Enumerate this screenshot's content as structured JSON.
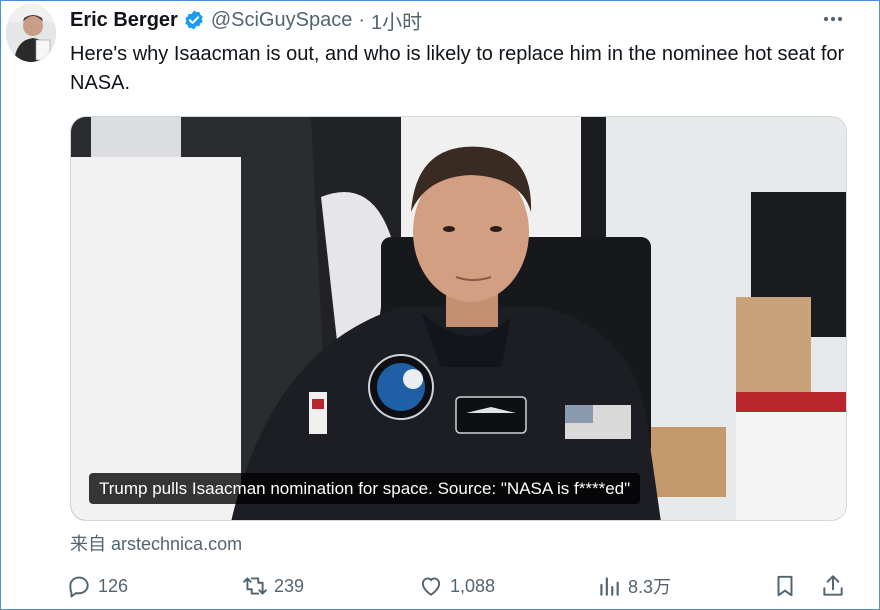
{
  "author": {
    "display_name": "Eric Berger",
    "handle": "@SciGuySpace",
    "separator": "·",
    "time": "1小时",
    "verified_color": "#1d9bf0"
  },
  "tweet": {
    "text": "Here's why Isaacman is out, and who is likely to replace him in the nominee hot seat for NASA."
  },
  "card": {
    "caption": "Trump pulls Isaacman nomination for space. Source: \"NASA is f****ed\"",
    "source_prefix": "来自",
    "source_domain": "arstechnica.com"
  },
  "actions": {
    "replies": "126",
    "retweets": "239",
    "likes": "1,088",
    "views": "8.3万"
  },
  "icons": {
    "more": "more-horizontal-icon",
    "reply": "reply-icon",
    "retweet": "retweet-icon",
    "like": "heart-icon",
    "views": "analytics-icon",
    "bookmark": "bookmark-icon",
    "share": "share-icon"
  },
  "colors": {
    "text_primary": "#0f1419",
    "text_secondary": "#536471",
    "frame_border": "#4a90d9"
  }
}
